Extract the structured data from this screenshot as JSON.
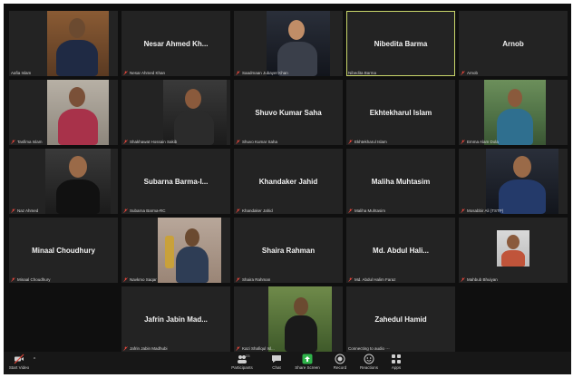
{
  "participants": [
    {
      "name": "Aafia Islam",
      "display": "",
      "video": true,
      "muted": false
    },
    {
      "name": "Nesar Ahmed Khan",
      "display": "Nesar Ahmed Kh...",
      "video": false,
      "muted": true
    },
    {
      "name": "Saadmaan Jubayer Khan",
      "display": "",
      "video": true,
      "muted": true
    },
    {
      "name": "Nibedita Barma",
      "display": "Nibedita Barma",
      "video": false,
      "muted": false,
      "active": true
    },
    {
      "name": "Arnob",
      "display": "Arnob",
      "video": false,
      "muted": true
    },
    {
      "name": "Tasfima Islam",
      "display": "",
      "video": true,
      "muted": true
    },
    {
      "name": "Shakhawat Hossain Sakib",
      "display": "",
      "video": true,
      "muted": true
    },
    {
      "name": "Shuvo Kumar Saha",
      "display": "Shuvo Kumar Saha",
      "video": false,
      "muted": true
    },
    {
      "name": "Ekhtekharul Islam",
      "display": "Ekhtekharul Islam",
      "video": false,
      "muted": true
    },
    {
      "name": "Emma Alam Dola",
      "display": "",
      "video": true,
      "muted": true
    },
    {
      "name": "Naz Ahmed",
      "display": "",
      "video": true,
      "muted": true
    },
    {
      "name": "Subarna Barma-RC",
      "display": "Subarna Barma-I...",
      "video": false,
      "muted": true
    },
    {
      "name": "Khandaker Jahid",
      "display": "Khandaker Jahid",
      "video": false,
      "muted": true
    },
    {
      "name": "Maliha Muhtasim",
      "display": "Maliha Muhtasim",
      "video": false,
      "muted": true
    },
    {
      "name": "Mosabbir Ali (TSTP)",
      "display": "",
      "video": true,
      "muted": true
    },
    {
      "name": "Minaal Choudhury",
      "display": "Minaal Choudhury",
      "video": false,
      "muted": true
    },
    {
      "name": "Navkmo Saqar",
      "display": "",
      "video": true,
      "muted": true
    },
    {
      "name": "Shaira Rahman",
      "display": "Shaira Rahman",
      "video": false,
      "muted": true
    },
    {
      "name": "Md. Abdul Halim Faraz",
      "display": "Md. Abdul Hali...",
      "video": false,
      "muted": true
    },
    {
      "name": "Mahbub Bhuiyan",
      "display": "",
      "video": true,
      "muted": true
    },
    {
      "name": "Jafrin Jabin Madhubi",
      "display": "Jafrin Jabin Mad...",
      "video": false,
      "muted": true
    },
    {
      "name": "Kazi Shafiqul Isl...",
      "display": "",
      "video": true,
      "muted": true
    },
    {
      "name": "Connecting to audio ···",
      "display": "Zahedul Hamid",
      "video": false,
      "muted": false
    }
  ],
  "toolbar": {
    "start_video": "Start Video",
    "participants": "Participants",
    "participants_count": "23",
    "chat": "Chat",
    "share_screen": "Share Screen",
    "record": "Record",
    "reactions": "Reactions",
    "apps": "Apps"
  },
  "colors": {
    "background": "#0f0f0f",
    "tile": "#232323",
    "active_border": "#c9d66a",
    "muted_icon": "#e0463b",
    "share_screen": "#2fb34a"
  }
}
